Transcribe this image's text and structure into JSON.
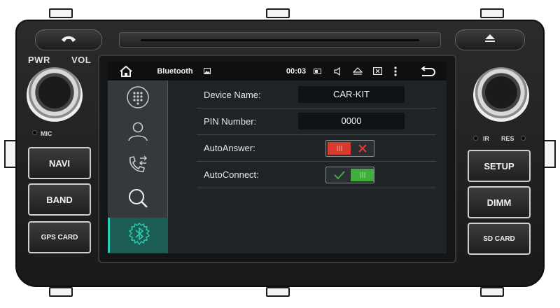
{
  "device": {
    "labels": {
      "pwr": "PWR",
      "vol": "VOL",
      "mic": "MIC",
      "ir": "IR",
      "res": "RES"
    },
    "left_buttons": [
      {
        "label": "NAVI"
      },
      {
        "label": "BAND"
      },
      {
        "label": "GPS CARD"
      }
    ],
    "right_buttons": [
      {
        "label": "SETUP"
      },
      {
        "label": "DIMM"
      },
      {
        "label": "SD CARD"
      }
    ],
    "icons": {
      "phone": "phone-icon",
      "eject": "eject-icon"
    }
  },
  "statusbar": {
    "title": "Bluetooth",
    "time": "00:03",
    "icons": [
      "home-icon",
      "image-icon",
      "battery-icon",
      "volume-icon",
      "eject-icon",
      "window-icon",
      "more-icon",
      "back-icon"
    ]
  },
  "sidebar": {
    "items": [
      {
        "icon": "dialpad-icon",
        "active": false
      },
      {
        "icon": "contact-icon",
        "active": false
      },
      {
        "icon": "call-log-icon",
        "active": false
      },
      {
        "icon": "search-icon",
        "active": false
      },
      {
        "icon": "bluetooth-icon",
        "active": true
      }
    ]
  },
  "settings": {
    "device_name": {
      "label": "Device Name:",
      "value": "CAR-KIT"
    },
    "pin_number": {
      "label": "PIN Number:",
      "value": "0000"
    },
    "auto_answer": {
      "label": "AutoAnswer:",
      "state": "off"
    },
    "auto_connect": {
      "label": "AutoConnect:",
      "state": "on"
    }
  },
  "colors": {
    "accent": "#2dcdb3",
    "toggle_off": "#d83a2e",
    "toggle_on": "#3fae3a"
  }
}
